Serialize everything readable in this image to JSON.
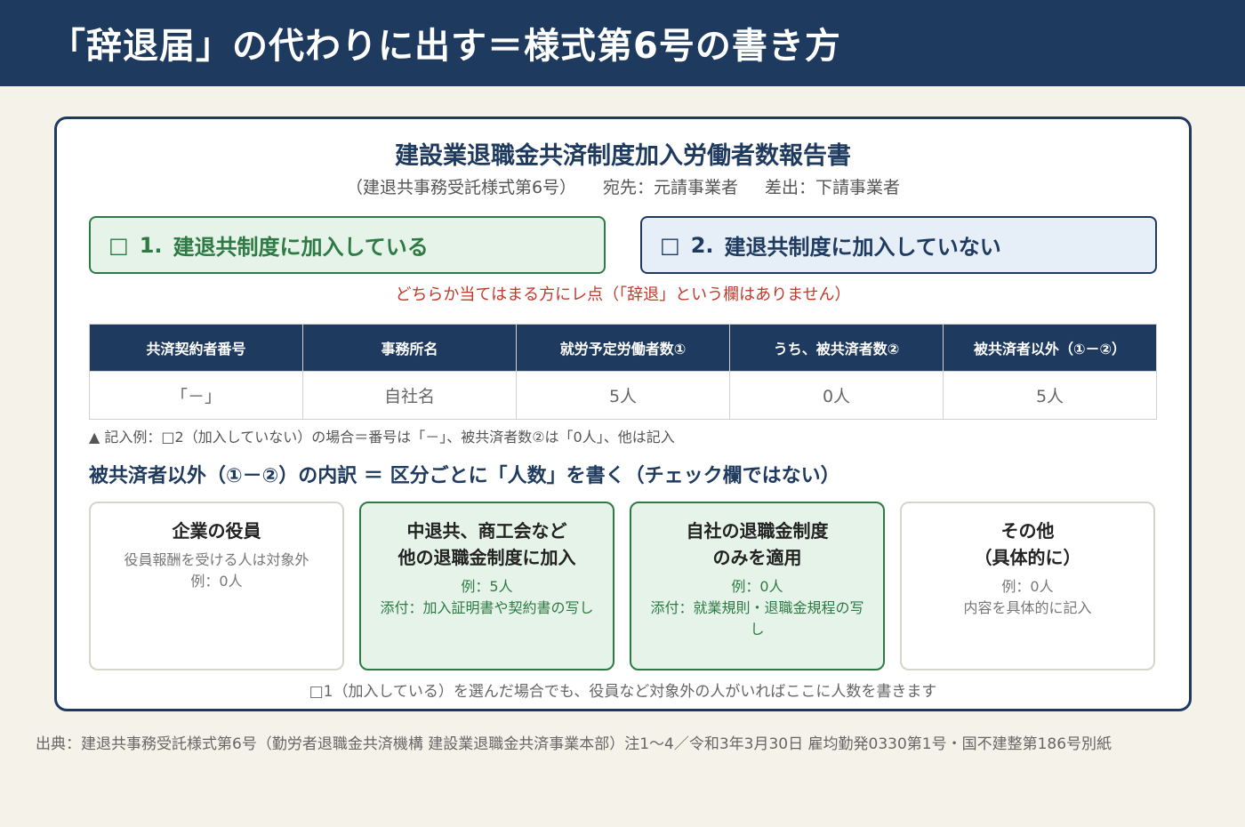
{
  "header": {
    "title": "「辞退届」の代わりに出す＝様式第6号の書き方"
  },
  "form": {
    "title": "建設業退職金共済制度加入労働者数報告書",
    "subtitle_form": "（建退共事務受託様式第6号）",
    "subtitle_to": "宛先：元請事業者",
    "subtitle_from": "差出：下請事業者"
  },
  "options": [
    {
      "box": "□",
      "num": "1.",
      "label": "建退共制度に加入している"
    },
    {
      "box": "□",
      "num": "2.",
      "label": "建退共制度に加入していない"
    }
  ],
  "note_red": "どちらか当てはまる方にレ点（「辞退」という欄はありません）",
  "table": {
    "headers": [
      "共済契約者番号",
      "事務所名",
      "就労予定労働者数①",
      "うち、被共済者数②",
      "被共済者以外（①－②）"
    ],
    "row": [
      "「－」",
      "自社名",
      "5人",
      "0人",
      "5人"
    ]
  },
  "table_note": "▲ 記入例：□2（加入していない）の場合＝番号は「－」、被共済者数②は「0人」、他は記入",
  "section_title": "被共済者以外（①－②）の内訳 ＝ 区分ごとに「人数」を書く（チェック欄ではない）",
  "categories": [
    {
      "title1": "企業の役員",
      "title2": "",
      "desc1": "役員報酬を受ける人は対象外",
      "desc2": "例：0人",
      "highlight": false
    },
    {
      "title1": "中退共、商工会など",
      "title2": "他の退職金制度に加入",
      "desc1": "例：5人",
      "desc2": "添付：加入証明書や契約書の写し",
      "highlight": true
    },
    {
      "title1": "自社の退職金制度",
      "title2": "のみを適用",
      "desc1": "例：0人",
      "desc2": "添付：就業規則・退職金規程の写し",
      "highlight": true
    },
    {
      "title1": "その他",
      "title2": "（具体的に）",
      "desc1": "例：0人",
      "desc2": "内容を具体的に記入",
      "highlight": false
    }
  ],
  "bottom_note": "□1（加入している）を選んだ場合でも、役員など対象外の人がいればここに人数を書きます",
  "source": "出典：建退共事務受託様式第6号（勤労者退職金共済機構 建設業退職金共済事業本部）注1〜4／令和3年3月30日 雇均勤発0330第1号・国不建整第186号別紙",
  "colors": {
    "navy": "#1e3a5f",
    "green": "#2e7a44",
    "red": "#c0392b",
    "background": "#f5f2ea"
  }
}
